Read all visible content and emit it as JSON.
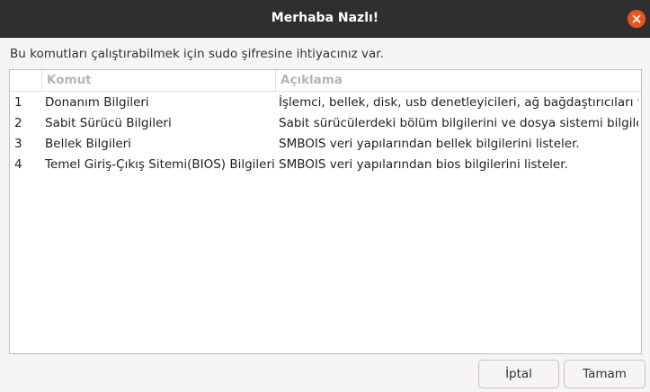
{
  "window": {
    "title": "Merhaba Nazlı!"
  },
  "message": "Bu komutları çalıştırabilmek için sudo şifresine ihtiyacınız var.",
  "table": {
    "headers": {
      "number": "",
      "command": "Komut",
      "description": "Açıklama"
    },
    "rows": [
      {
        "num": "1",
        "command": "Donanım Bilgileri",
        "description": "İşlemci, bellek, disk, usb denetleyicileri, ağ bağdaştırıcıları vb"
      },
      {
        "num": "2",
        "command": "Sabit Sürücü Bilgileri",
        "description": "Sabit sürücülerdeki bölüm bilgilerini ve dosya sistemi bilgiler"
      },
      {
        "num": "3",
        "command": "Bellek Bilgileri",
        "description": "SMBOIS veri yapılarından bellek bilgilerini listeler."
      },
      {
        "num": "4",
        "command": "Temel Giriş-Çıkış Sitemi(BIOS) Bilgileri",
        "description": "SMBOIS veri yapılarından bios bilgilerini listeler."
      }
    ]
  },
  "buttons": {
    "cancel": "İptal",
    "ok": "Tamam"
  },
  "icons": {
    "close": "close-icon"
  },
  "colors": {
    "titlebar": "#2f2f2f",
    "close_button": "#e9541f",
    "background": "#f6f5f4"
  }
}
